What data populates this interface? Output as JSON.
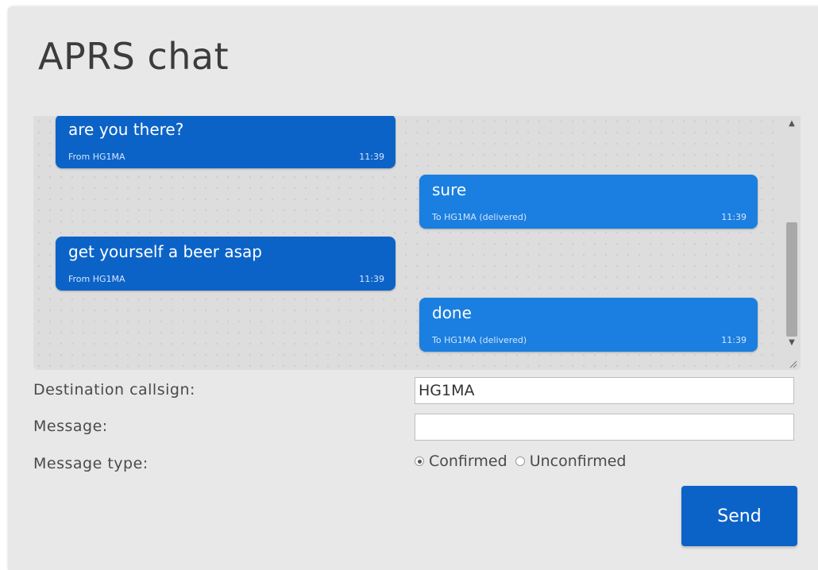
{
  "app": {
    "title": "APRS chat"
  },
  "messages": [
    {
      "direction": "in",
      "text": "are you there?",
      "meta": "From HG1MA",
      "time": "11:39"
    },
    {
      "direction": "out",
      "text": "sure",
      "meta": "To HG1MA (delivered)",
      "time": "11:39"
    },
    {
      "direction": "in",
      "text": "get yourself a beer asap",
      "meta": "From HG1MA",
      "time": "11:39"
    },
    {
      "direction": "out",
      "text": "done",
      "meta": "To HG1MA (delivered)",
      "time": "11:39"
    }
  ],
  "form": {
    "destination_label": "Destination callsign:",
    "destination_value": "HG1MA",
    "message_label": "Message:",
    "message_value": "",
    "type_label": "Message type:",
    "type_options": [
      {
        "label": "Confirmed",
        "checked": true
      },
      {
        "label": "Unconfirmed",
        "checked": false
      }
    ],
    "send_label": "Send"
  },
  "colors": {
    "incoming_bubble": "#0c63c7",
    "outgoing_bubble": "#1a7fe0",
    "send_button": "#0c63c7"
  }
}
